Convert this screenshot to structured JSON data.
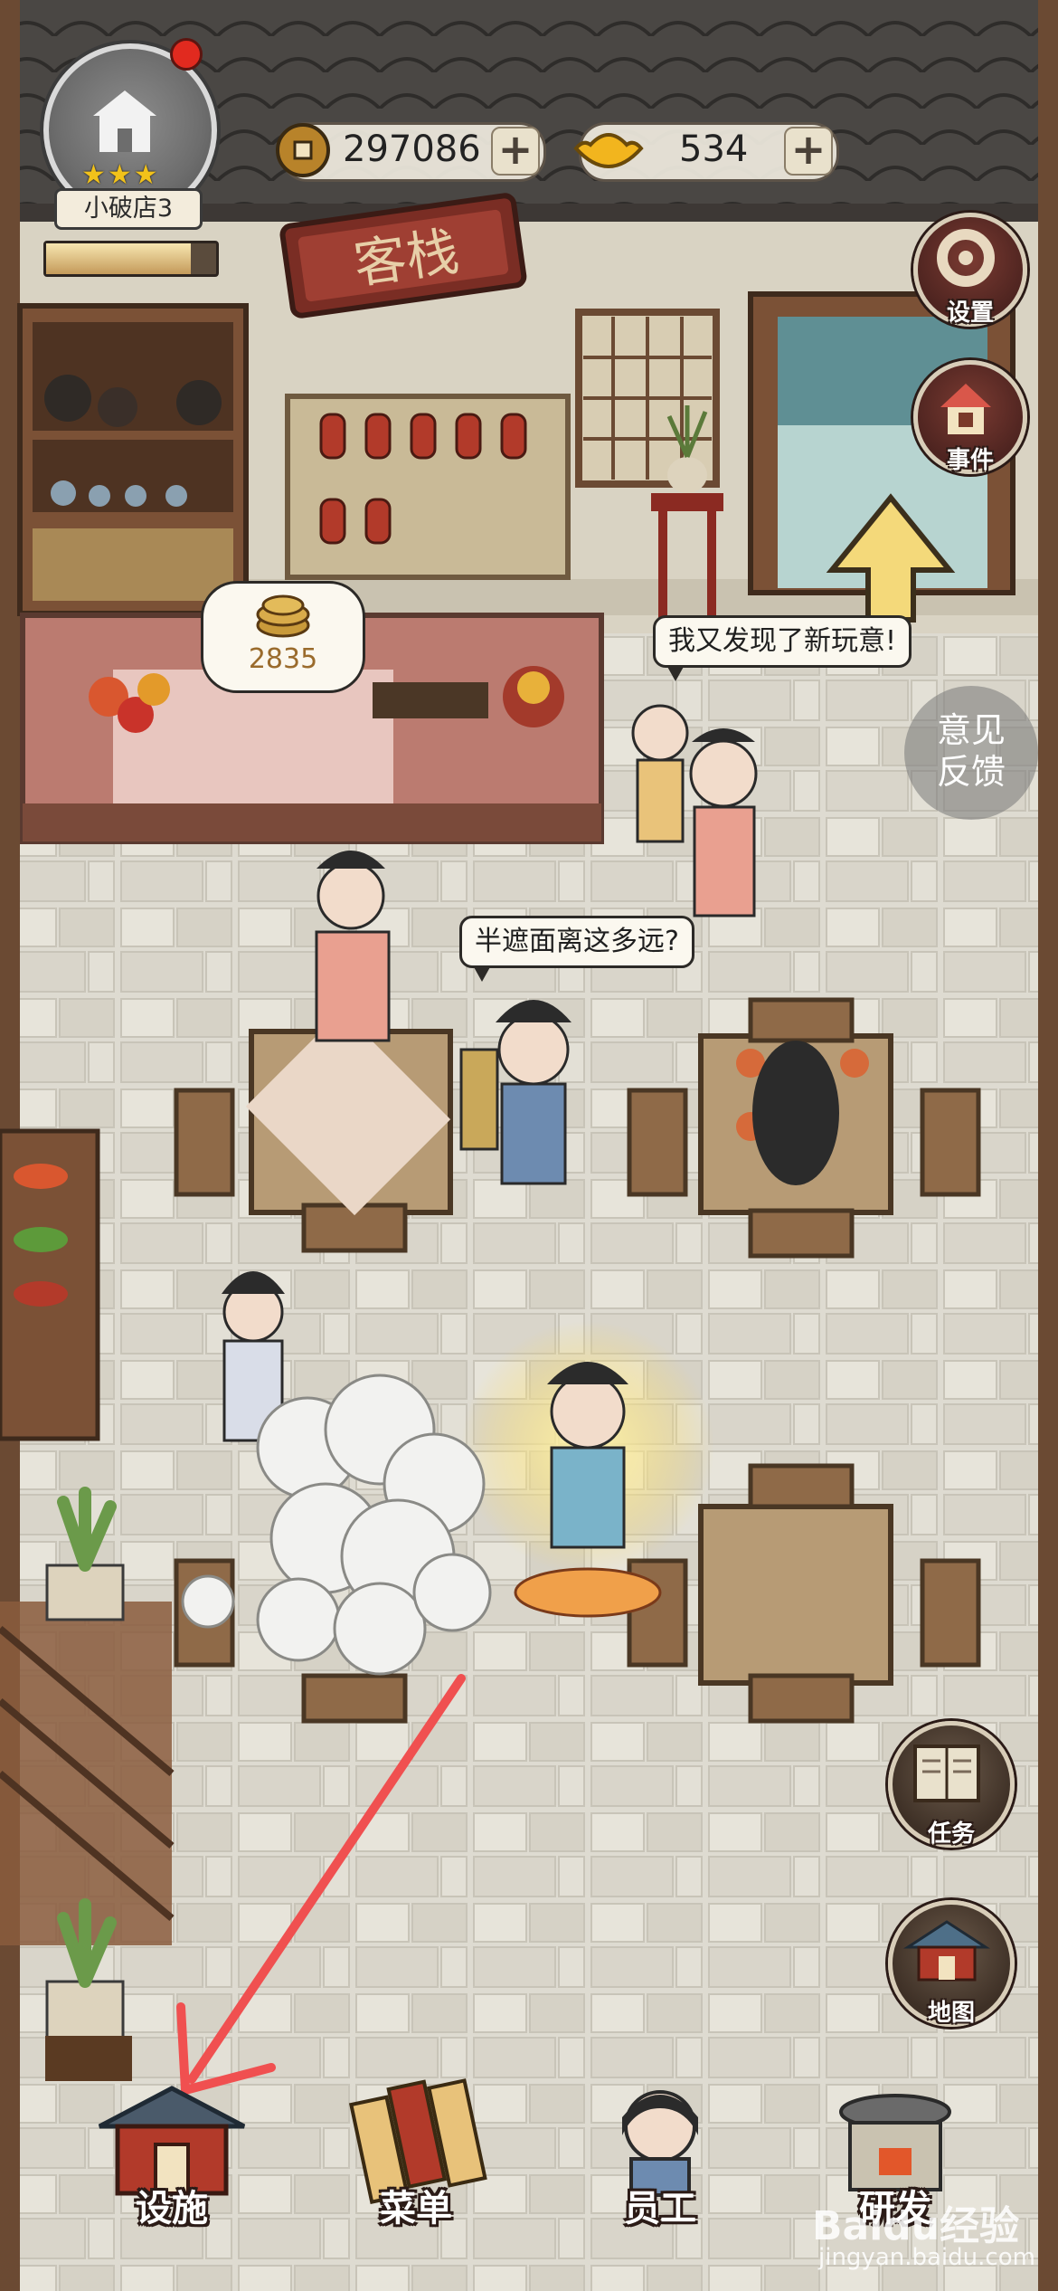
{
  "hud": {
    "store_name": "小破店3",
    "store_stars": 3,
    "store_progress_fraction": 0.85,
    "coins": "297086",
    "gold_ingots": "534",
    "add_symbol": "+"
  },
  "side_buttons": {
    "settings": "设置",
    "events": "事件",
    "feedback_line1": "意见",
    "feedback_line2": "反馈",
    "tasks": "任务",
    "map": "地图"
  },
  "scene_text": {
    "inn_sign": "客栈",
    "coin_bubble_value": "2835",
    "speech_1": "我又发现了新玩意!",
    "speech_2": "半遮面离这多远?"
  },
  "bottom_nav": {
    "facilities": "设施",
    "menu": "菜单",
    "staff": "员工",
    "research": "研发"
  },
  "watermark": {
    "brand": "Baidu经验",
    "url": "jingyan.baidu.com"
  },
  "colors": {
    "annotation_arrow": "#f05050",
    "floor": "#dcd8cc",
    "wood": "#7b5136",
    "notify_dot": "#e12a1f"
  }
}
